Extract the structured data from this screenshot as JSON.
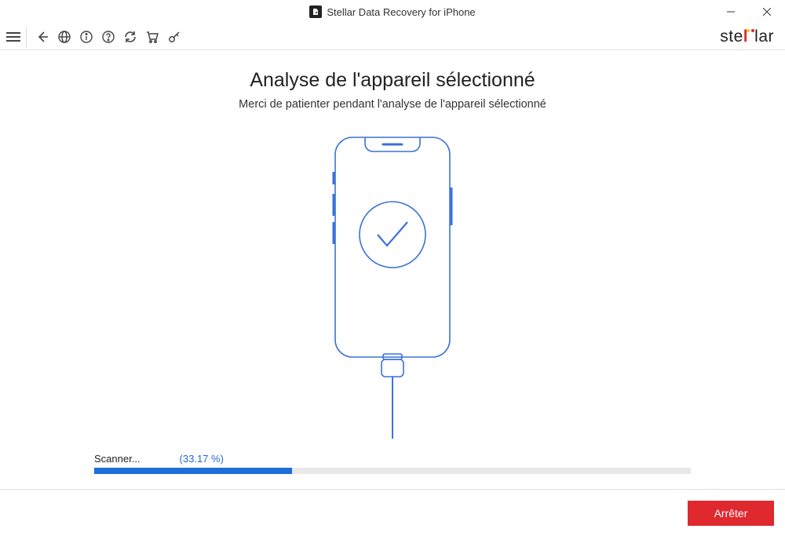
{
  "window": {
    "title": "Stellar Data Recovery for iPhone"
  },
  "brand": {
    "name_pre": "ste",
    "name_mid": "l",
    "name_mid2": "l",
    "name_post": "ar"
  },
  "main": {
    "heading": "Analyse de l'appareil sélectionné",
    "subtitle": "Merci de patienter pendant l'analyse de l'appareil sélectionné"
  },
  "progress": {
    "status_label": "Scanner...",
    "percent_label": "(33.17 %)",
    "percent": 33.17
  },
  "footer": {
    "stop_label": "Arrêter"
  }
}
